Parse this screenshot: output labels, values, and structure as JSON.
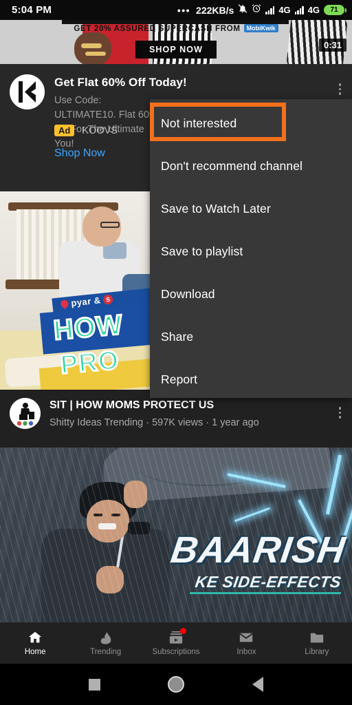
{
  "status_bar": {
    "time": "5:04 PM",
    "overflow_dots": "•••",
    "network_speed": "222KB/s",
    "icons": [
      "bell-mute-icon",
      "alarm-icon",
      "signal-icon",
      "signal-icon"
    ],
    "network_1": "4G",
    "network_2": "4G",
    "network_2_suffix": "ır",
    "battery_level": "71"
  },
  "ad_banner": {
    "headline": "GET 20% ASSURED SUPERCASH FROM",
    "brand_logo": "MobiKwik",
    "cta": "SHOP NOW",
    "timer": "0:31"
  },
  "ad_card": {
    "title": "Get Flat 60% Off Today!",
    "description": "Use Code: ULTIMATE10. Flat 60% Off For The Ultimate You!",
    "badge": "Ad",
    "advertiser": "KOOVS",
    "cta": "Shop Now",
    "avatar_letter": "K"
  },
  "menu": {
    "highlighted_index": 0,
    "highlight_color": "#f4701c",
    "items": [
      {
        "label": "Not interested"
      },
      {
        "label": "Don't recommend channel"
      },
      {
        "label": "Save to Watch Later"
      },
      {
        "label": "Save to playlist"
      },
      {
        "label": "Download"
      },
      {
        "label": "Share"
      },
      {
        "label": "Report"
      }
    ]
  },
  "video_1": {
    "thumbnail_text_brand": "pyar",
    "thumbnail_text_amp": "&",
    "thumbnail_text_sit": "S",
    "thumbnail_line1": "HOW",
    "thumbnail_line2": "PRO",
    "title": "SIT | HOW MOMS PROTECT US",
    "channel": "Shitty Ideas Trending",
    "views": "597K views",
    "age": "1 year ago",
    "meta": "Shitty Ideas Trending · 597K views · 1 year ago"
  },
  "video_2": {
    "thumbnail_title": "BAARISH",
    "thumbnail_subtitle": "KE SIDE-EFFECTS"
  },
  "bottom_nav": {
    "items": [
      {
        "label": "Home",
        "icon": "home-icon",
        "active": true,
        "badge": false
      },
      {
        "label": "Trending",
        "icon": "flame-icon",
        "active": false,
        "badge": false
      },
      {
        "label": "Subscriptions",
        "icon": "subscriptions-icon",
        "active": false,
        "badge": true
      },
      {
        "label": "Inbox",
        "icon": "envelope-icon",
        "active": false,
        "badge": false
      },
      {
        "label": "Library",
        "icon": "folder-icon",
        "active": false,
        "badge": false
      }
    ]
  },
  "android_nav": {
    "recents": "square-icon",
    "home": "circle-icon",
    "back": "triangle-back-icon"
  },
  "colors": {
    "app_background": "#212121",
    "card_background": "#282828",
    "menu_background": "#383838",
    "accent_link": "#3ea6ff",
    "ad_badge": "#fbc02d",
    "highlight": "#f4701c",
    "battery": "#7ed957"
  }
}
